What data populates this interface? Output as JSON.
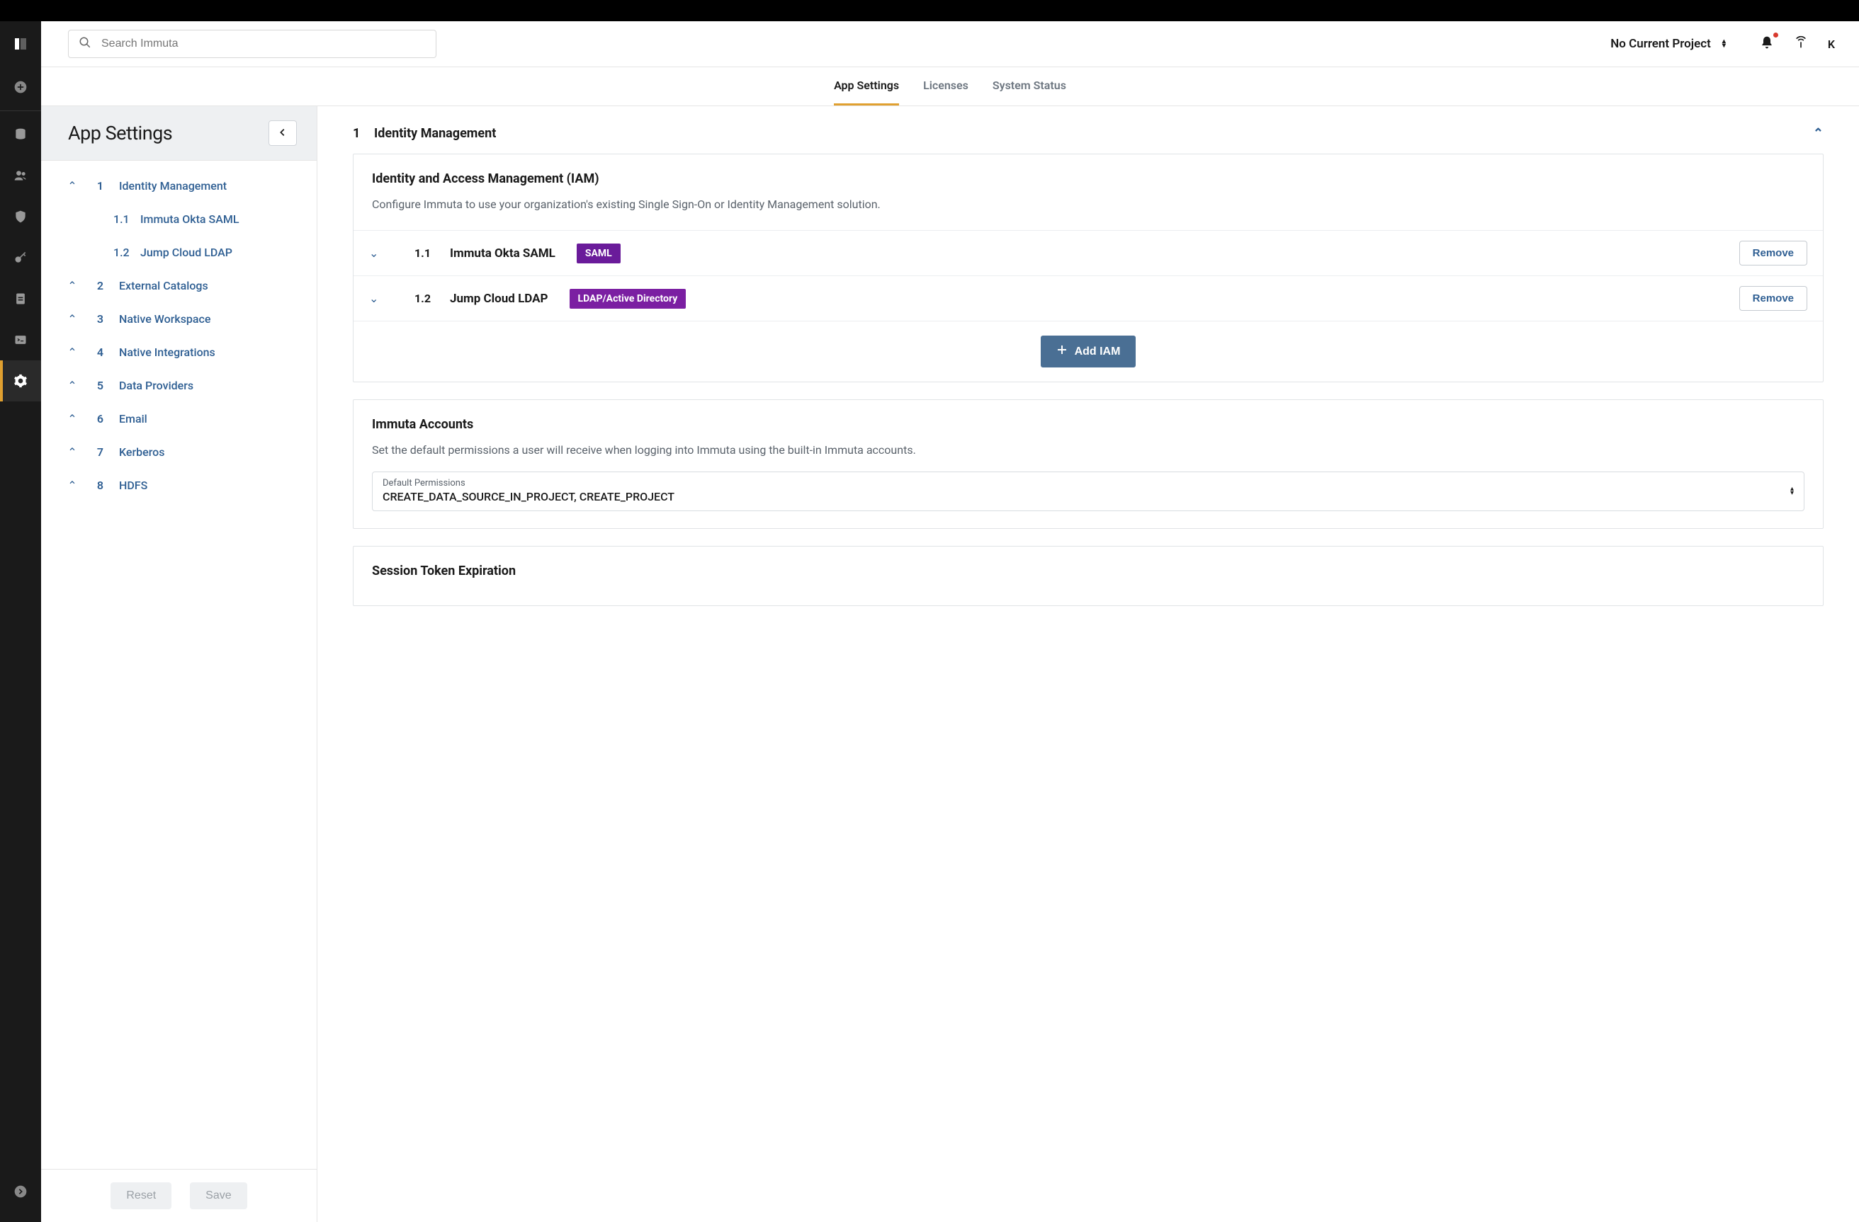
{
  "topbar": {
    "search_placeholder": "Search Immuta",
    "project_label": "No Current Project",
    "avatar_initial": "K"
  },
  "tabs": [
    {
      "label": "App Settings",
      "active": true
    },
    {
      "label": "Licenses",
      "active": false
    },
    {
      "label": "System Status",
      "active": false
    }
  ],
  "sidenav": {
    "title": "App Settings",
    "items": [
      {
        "num": "1",
        "label": "Identity Management",
        "expanded": true,
        "children": [
          {
            "num": "1.1",
            "label": "Immuta Okta SAML"
          },
          {
            "num": "1.2",
            "label": "Jump Cloud LDAP"
          }
        ]
      },
      {
        "num": "2",
        "label": "External Catalogs"
      },
      {
        "num": "3",
        "label": "Native Workspace"
      },
      {
        "num": "4",
        "label": "Native Integrations"
      },
      {
        "num": "5",
        "label": "Data Providers"
      },
      {
        "num": "6",
        "label": "Email"
      },
      {
        "num": "7",
        "label": "Kerberos"
      },
      {
        "num": "8",
        "label": "HDFS"
      }
    ],
    "footer": {
      "reset": "Reset",
      "save": "Save"
    }
  },
  "content": {
    "section": {
      "num": "1",
      "title": "Identity Management"
    },
    "iam_card": {
      "title": "Identity and Access Management (IAM)",
      "desc": "Configure Immuta to use your organization's existing Single Sign-On or Identity Management solution.",
      "rows": [
        {
          "num": "1.1",
          "name": "Immuta Okta SAML",
          "badge": "SAML",
          "badge_class": "saml",
          "remove": "Remove"
        },
        {
          "num": "1.2",
          "name": "Jump Cloud LDAP",
          "badge": "LDAP/Active Directory",
          "badge_class": "ldap",
          "remove": "Remove"
        }
      ],
      "add_label": "Add IAM"
    },
    "accounts_card": {
      "title": "Immuta Accounts",
      "desc": "Set the default permissions a user will receive when logging into Immuta using the built-in Immuta accounts.",
      "field_label": "Default Permissions",
      "field_value": "CREATE_DATA_SOURCE_IN_PROJECT, CREATE_PROJECT"
    },
    "session_card": {
      "title": "Session Token Expiration"
    }
  }
}
